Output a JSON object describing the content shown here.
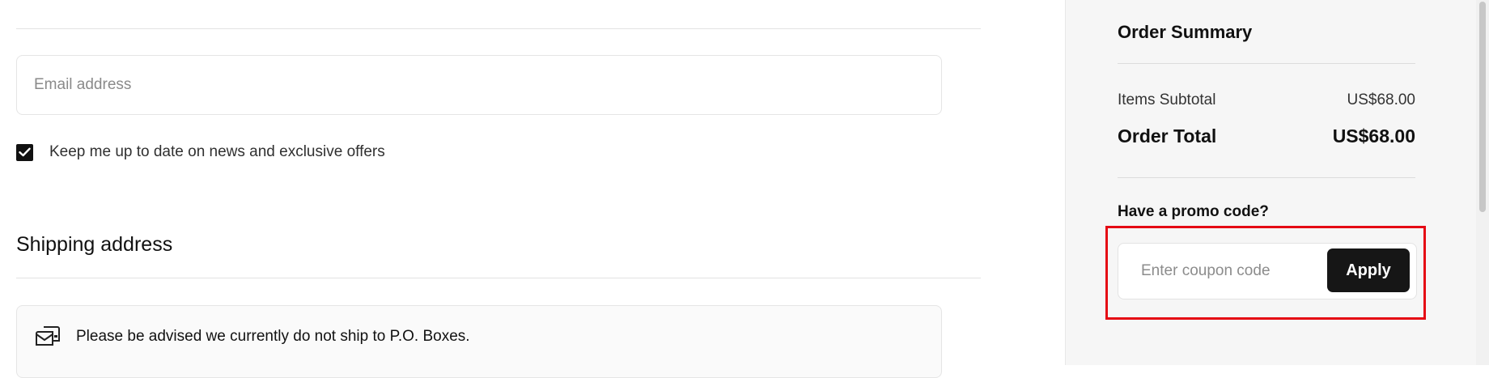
{
  "contact": {
    "email_placeholder": "Email address",
    "newsletter_checked": true,
    "newsletter_label": "Keep me up to date on news and exclusive offers"
  },
  "shipping": {
    "title": "Shipping address",
    "notice_icon": "mailbox-icon",
    "notice_text": "Please be advised we currently do not ship to P.O. Boxes."
  },
  "order_summary": {
    "title": "Order Summary",
    "subtotal_label": "Items Subtotal",
    "subtotal_value": "US$68.00",
    "total_label": "Order Total",
    "total_value": "US$68.00",
    "promo_label": "Have a promo code?",
    "coupon_placeholder": "Enter coupon code",
    "apply_label": "Apply"
  },
  "colors": {
    "highlight": "#e50914",
    "button": "#161616",
    "sidebar_bg": "#f6f6f6"
  }
}
